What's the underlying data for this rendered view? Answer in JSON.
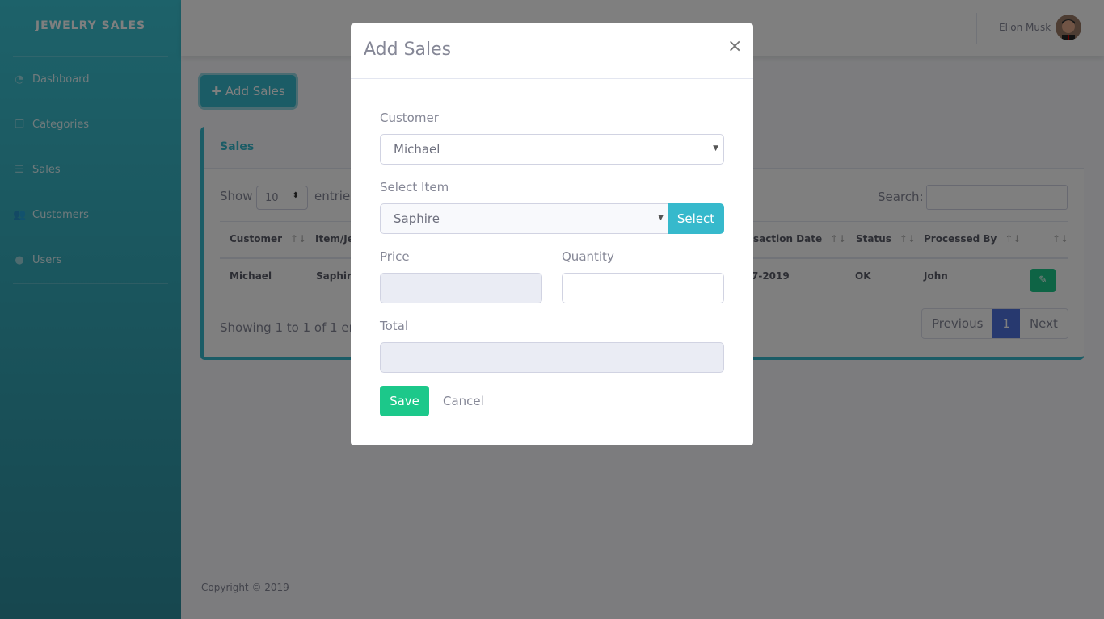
{
  "sidebar": {
    "brand": "JEWELRY SALES",
    "items": [
      {
        "label": "Dashboard",
        "icon": "dashboard-icon"
      },
      {
        "label": "Categories",
        "icon": "copy-icon"
      },
      {
        "label": "Sales",
        "icon": "list-icon"
      },
      {
        "label": "Customers",
        "icon": "users-icon"
      },
      {
        "label": "Users",
        "icon": "user-icon"
      }
    ]
  },
  "topbar": {
    "user_name": "Elion Musk"
  },
  "main": {
    "add_button": "Add Sales",
    "card_title": "Sales",
    "show_label": "Show",
    "entries_value": "10",
    "entries_label": "entries",
    "search_label": "Search:",
    "columns": [
      "Customer",
      "Item/Je",
      "saction Date",
      "Status",
      "Processed By"
    ],
    "row": {
      "customer": "Michael",
      "item": "Saphire",
      "date": "7-2019",
      "status": "OK",
      "processed_by": "John"
    },
    "info": "Showing 1 to 1 of 1 en",
    "pager": {
      "prev": "Previous",
      "page": "1",
      "next": "Next"
    },
    "copyright": "Copyright © 2019"
  },
  "modal": {
    "title": "Add Sales",
    "close": "×",
    "customer_label": "Customer",
    "customer_value": "Michael",
    "item_label": "Select Item",
    "item_value": "Saphire",
    "select_button": "Select",
    "price_label": "Price",
    "price_value": "",
    "quantity_label": "Quantity",
    "quantity_value": "",
    "total_label": "Total",
    "total_value": "",
    "save": "Save",
    "cancel": "Cancel"
  },
  "colors": {
    "accent": "#36b9cc",
    "success": "#1cc88a",
    "primary": "#4e73df"
  }
}
